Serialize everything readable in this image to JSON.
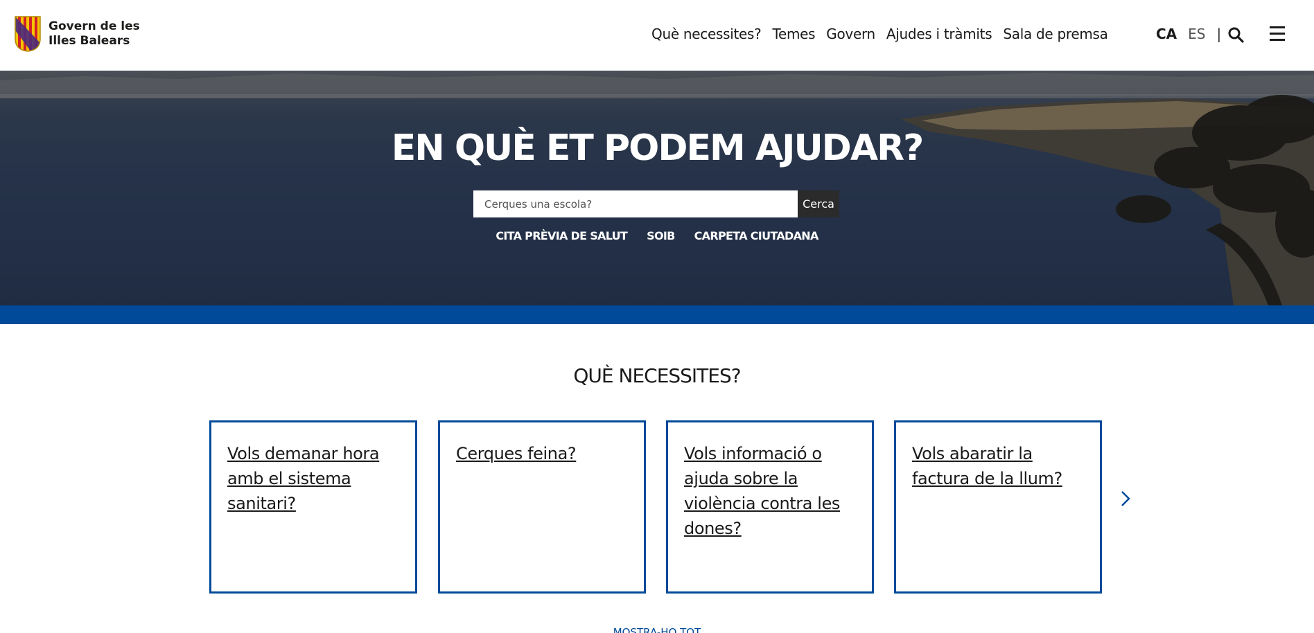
{
  "header": {
    "logo_line1": "Govern de les",
    "logo_line2": "Illes Balears",
    "nav": [
      "Què necessites?",
      "Temes",
      "Govern",
      "Ajudes i tràmits",
      "Sala de premsa"
    ],
    "lang_active": "CA",
    "lang_other": "ES",
    "lang_separator": "|"
  },
  "hero": {
    "title": "EN QUÈ ET PODEM AJUDAR?",
    "search_placeholder": "Cerques una escola?",
    "search_button": "Cerca",
    "quicklinks": [
      "CITA PRÈVIA DE SALUT",
      "SOIB",
      "CARPETA CIUTADANA"
    ]
  },
  "needs": {
    "title": "QUÈ NECESSITES?",
    "cards": [
      "Vols demanar hora amb el sistema sanitari?",
      "Cerques feina?",
      "Vols informació o ajuda sobre la violència contra les dones?",
      "Vols abaratir la factura de la llum?"
    ],
    "more_link": "MOSTRA-HO TOT"
  },
  "colors": {
    "brand_blue": "#004a99",
    "button_dark": "#2b2b2b"
  },
  "icons": [
    "balearic-shield-icon",
    "search-icon",
    "hamburger-menu-icon",
    "chevron-right-icon"
  ]
}
